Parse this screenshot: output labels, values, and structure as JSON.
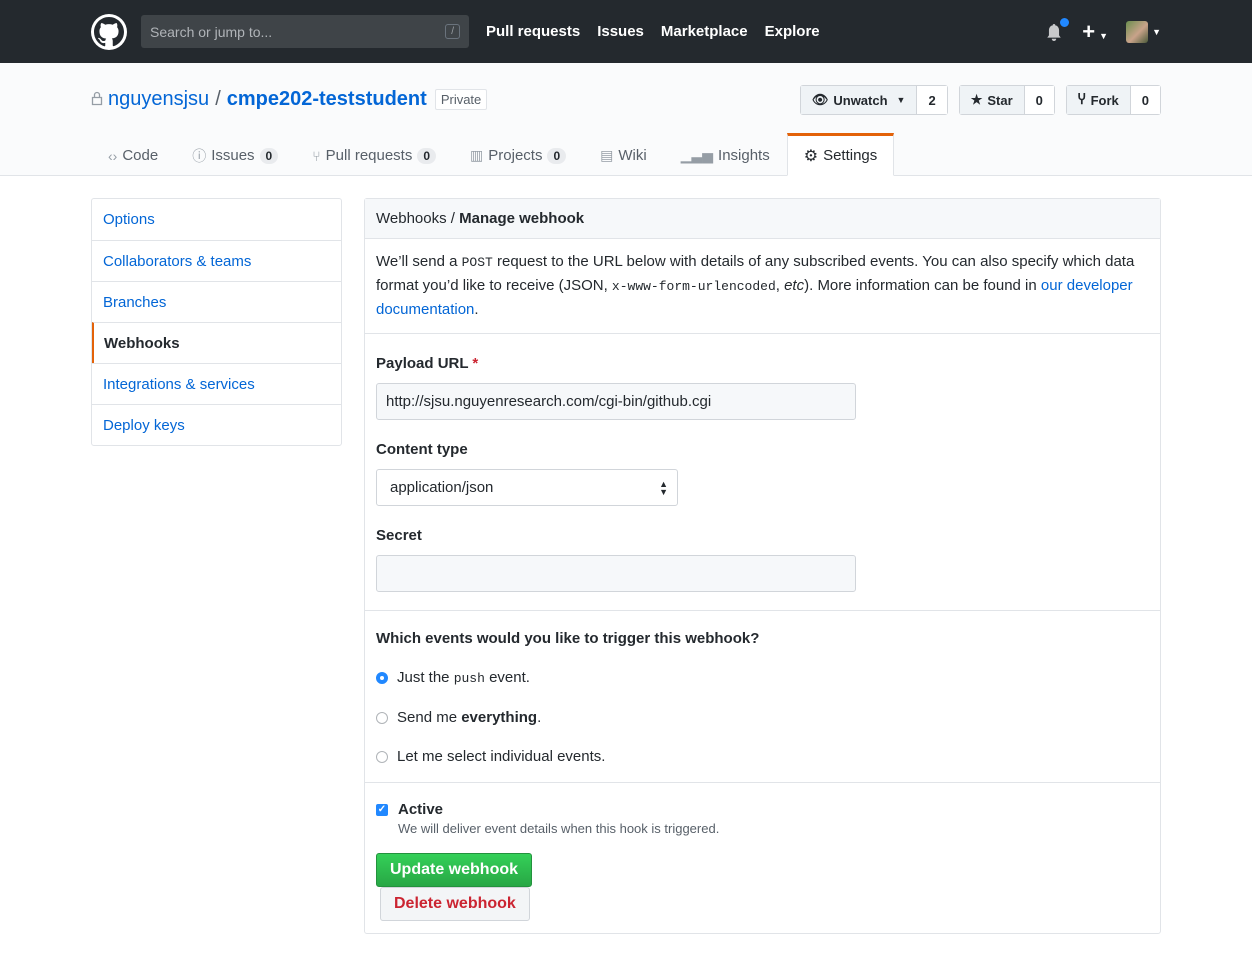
{
  "header": {
    "search_placeholder": "Search or jump to...",
    "slash": "/",
    "nav": [
      "Pull requests",
      "Issues",
      "Marketplace",
      "Explore"
    ],
    "plus": "+"
  },
  "repo": {
    "owner": "nguyensjsu",
    "sep": "/",
    "name": "cmpe202-teststudent",
    "visibility": "Private",
    "watch": {
      "label": "Unwatch",
      "count": "2"
    },
    "star": {
      "label": "Star",
      "count": "0"
    },
    "fork": {
      "label": "Fork",
      "count": "0"
    }
  },
  "tabs": [
    {
      "label": "Code"
    },
    {
      "label": "Issues",
      "count": "0"
    },
    {
      "label": "Pull requests",
      "count": "0"
    },
    {
      "label": "Projects",
      "count": "0"
    },
    {
      "label": "Wiki"
    },
    {
      "label": "Insights"
    },
    {
      "label": "Settings"
    }
  ],
  "sidebar": [
    "Options",
    "Collaborators & teams",
    "Branches",
    "Webhooks",
    "Integrations & services",
    "Deploy keys"
  ],
  "main": {
    "breadcrumb": {
      "parent": "Webhooks",
      "sep": " / ",
      "current": "Manage webhook"
    },
    "intro": {
      "t1": "We’ll send a ",
      "c1": "POST",
      "t2": " request to the URL below with details of any subscribed events. You can also specify which data format you’d like to receive (JSON, ",
      "c2": "x-www-form-urlencoded",
      "t3": ", ",
      "em": "etc",
      "t4": "). More information can be found in ",
      "link": "our developer documentation",
      "t5": "."
    },
    "payload_label": "Payload URL",
    "required": "*",
    "payload_value": "http://sjsu.nguyenresearch.com/cgi-bin/github.cgi",
    "content_type_label": "Content type",
    "content_type_value": "application/json",
    "secret_label": "Secret",
    "secret_value": "",
    "events_question": "Which events would you like to trigger this webhook?",
    "events": {
      "o1a": "Just the ",
      "o1c": "push",
      "o1b": " event.",
      "o2a": "Send me ",
      "o2b": "everything",
      "o2c": ".",
      "o3": "Let me select individual events."
    },
    "selected_event": "push",
    "active_label": "Active",
    "active_checked": true,
    "active_note": "We will deliver event details when this hook is triggered.",
    "update_button": "Update webhook",
    "delete_button": "Delete webhook"
  },
  "colors": {
    "accent": "#e36209",
    "link": "#0366d6",
    "primary_button": "#28a745",
    "danger": "#cb2431"
  }
}
